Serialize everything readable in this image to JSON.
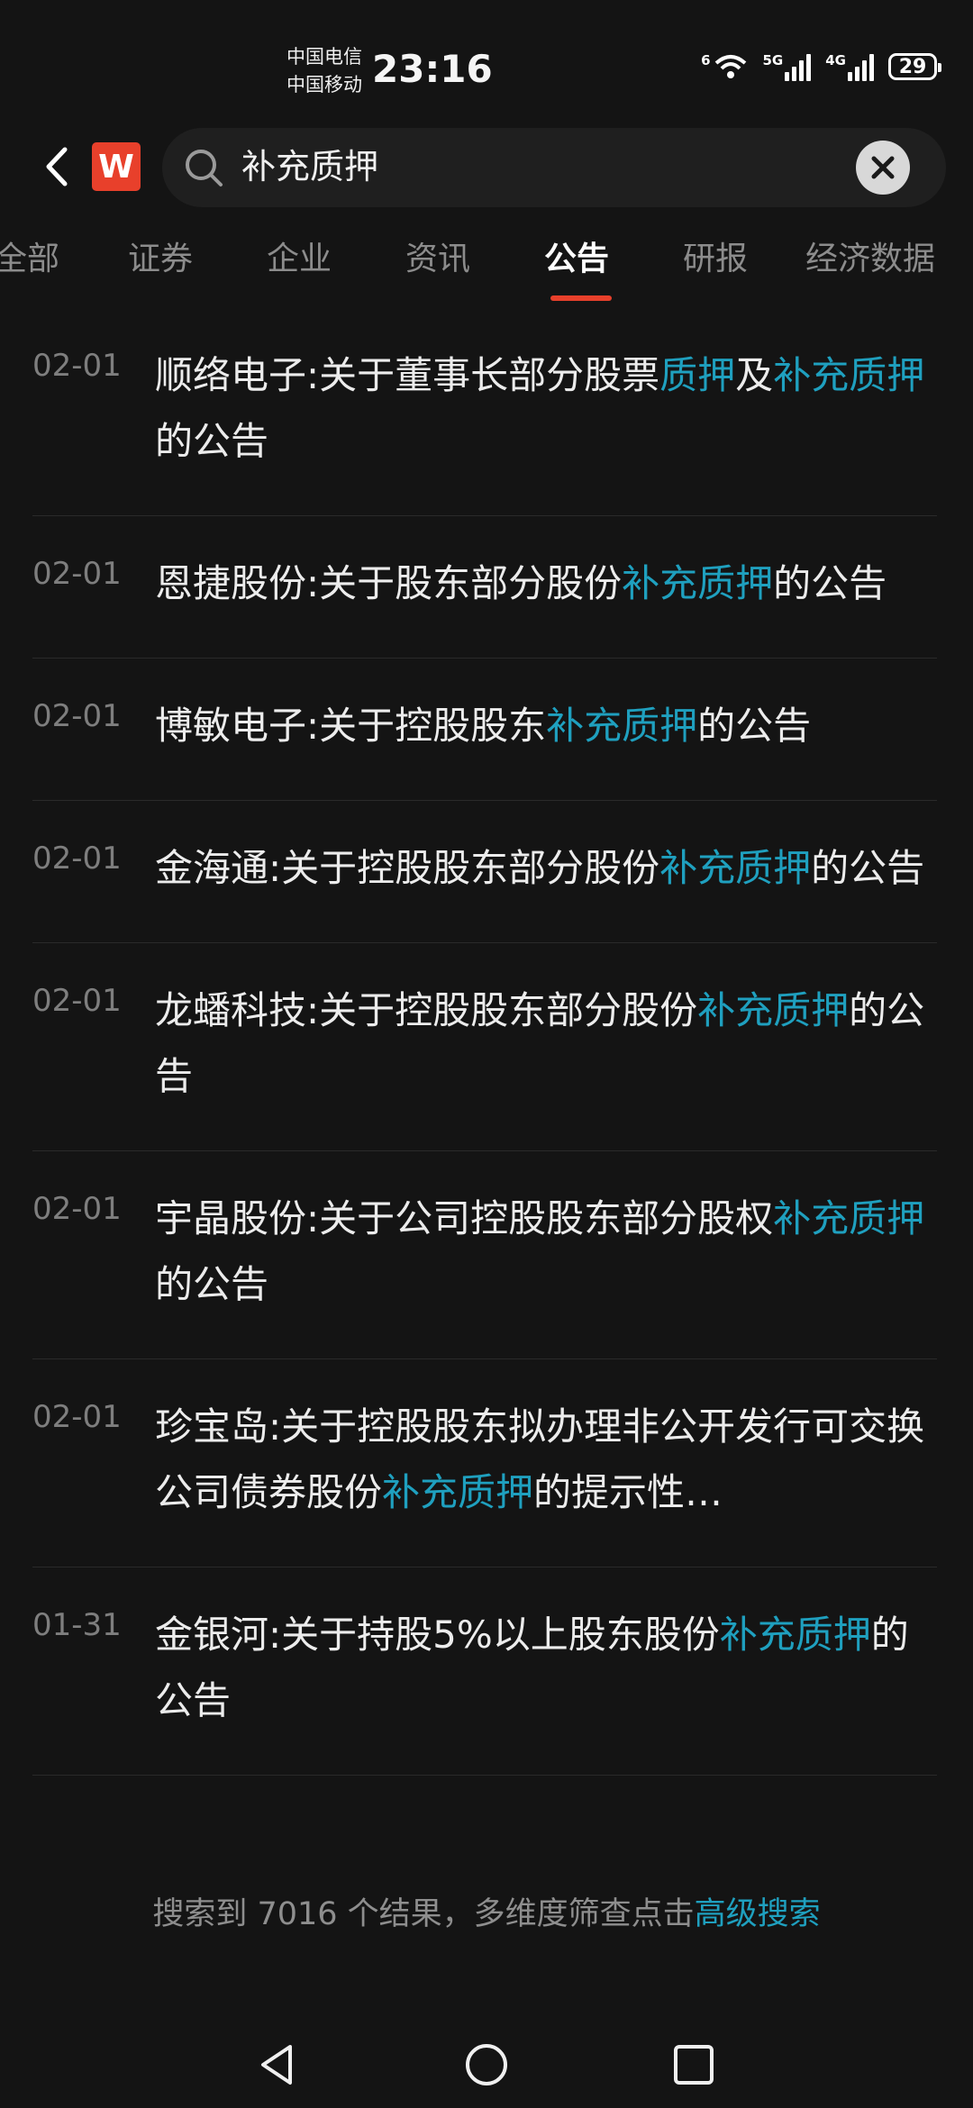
{
  "status_bar": {
    "carrier_1": "中国电信",
    "carrier_2": "中国移动",
    "time": "23:16",
    "wifi_tag": "6",
    "sim1_tag": "5G",
    "sim2_tag": "4G",
    "battery": "29"
  },
  "header": {
    "logo_letter": "W",
    "search_value": "补充质押"
  },
  "tabs": [
    "全部",
    "证券",
    "企业",
    "资讯",
    "公告",
    "研报",
    "经济数据"
  ],
  "active_tab": "公告",
  "results": [
    {
      "date": "02-01",
      "parts": [
        "顺络电子:关于董事长部分股票",
        "质押",
        "及",
        "补充质押",
        "的公告"
      ]
    },
    {
      "date": "02-01",
      "parts": [
        "恩捷股份:关于股东部分股份",
        "补充质押",
        "的公告"
      ]
    },
    {
      "date": "02-01",
      "parts": [
        "博敏电子:关于控股股东",
        "补充质押",
        "的公告"
      ]
    },
    {
      "date": "02-01",
      "parts": [
        "金海通:关于控股股东部分股份",
        "补充质押",
        "的公告"
      ]
    },
    {
      "date": "02-01",
      "parts": [
        "龙蟠科技:关于控股股东部分股份",
        "补充质押",
        "的公告"
      ]
    },
    {
      "date": "02-01",
      "parts": [
        "宇晶股份:关于公司控股股东部分股权",
        "补充质押",
        "的公告"
      ]
    },
    {
      "date": "02-01",
      "parts": [
        "珍宝岛:关于控股股东拟办理非公开发行可交换公司债券股份",
        "补充质押",
        "的提示性…"
      ]
    },
    {
      "date": "01-31",
      "parts": [
        "金银河:关于持股5%以上股东股份",
        "补充质押",
        "的公告"
      ]
    }
  ],
  "footer": {
    "text": "搜索到 7016 个结果，多维度筛查点击",
    "link": "高级搜索"
  },
  "colors": {
    "background": "#141414",
    "highlight": "#1fa0bf",
    "accent": "#e8402b"
  }
}
